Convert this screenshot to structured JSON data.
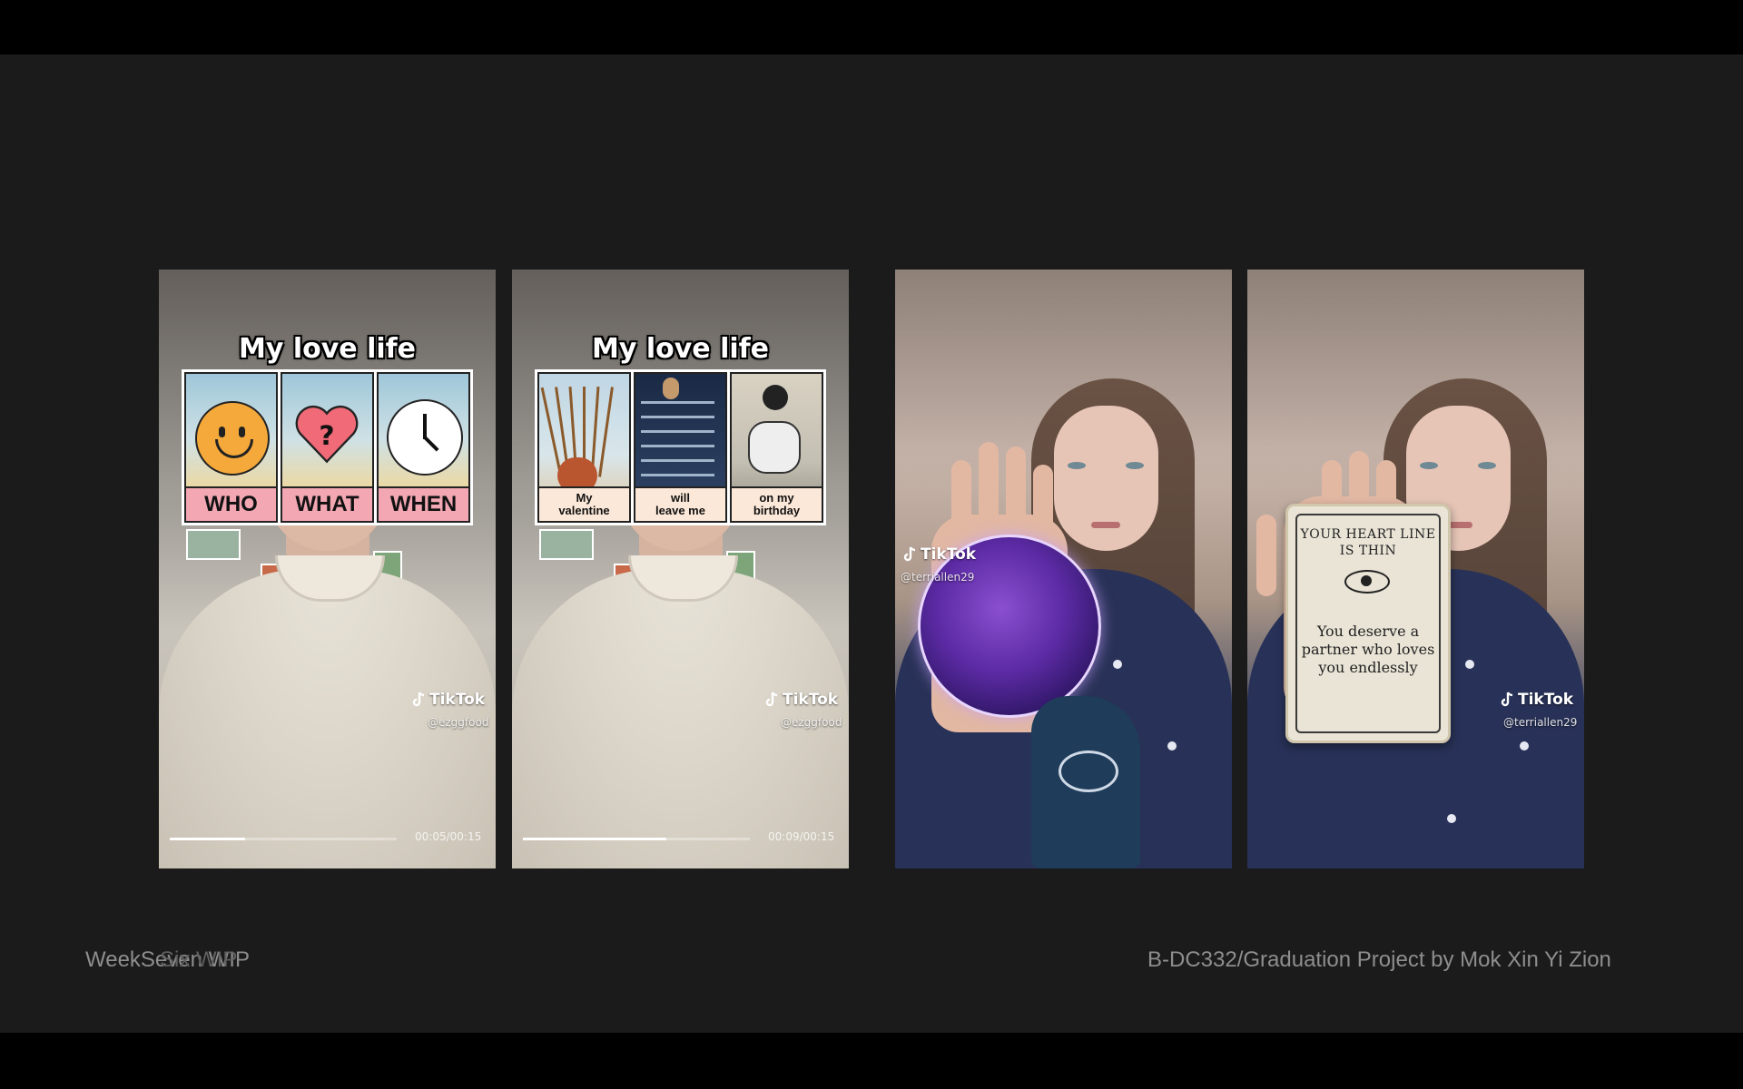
{
  "slide": {
    "footer_left": "WeekSeven WIP",
    "footer_left_ghost": "Six WIP",
    "footer_right": "B-DC332/Graduation Project by Mok Xin Yi Zion"
  },
  "videos": [
    {
      "overlay_title": "My love life",
      "cards": [
        "WHO",
        "WHAT",
        "WHEN"
      ],
      "brand": "TikTok",
      "handle": "@ezggfood",
      "timecode": "00:05/00:15",
      "progress": 0.33
    },
    {
      "overlay_title": "My love life",
      "cards": [
        "My\nvalentine",
        "will\nleave me",
        "on my\nbirthday"
      ],
      "brand": "TikTok",
      "handle": "@ezggfood",
      "timecode": "00:09/00:15",
      "progress": 0.63
    },
    {
      "brand": "TikTok",
      "handle": "@terriallen29"
    },
    {
      "brand": "TikTok",
      "handle": "@terriallen29",
      "card_title": "YOUR HEART LINE\nIS THIN",
      "card_text": "You deserve a\npartner who loves\nyou endlessly"
    }
  ]
}
